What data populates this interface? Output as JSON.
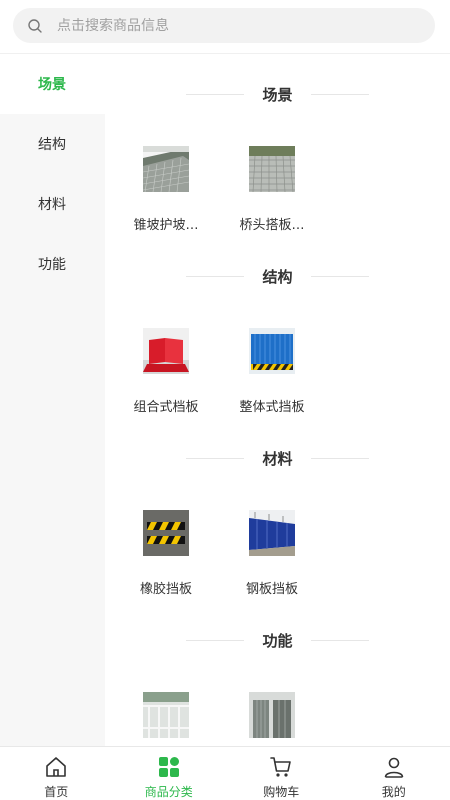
{
  "search": {
    "placeholder": "点击搜索商品信息"
  },
  "sidebar": {
    "active_color": "#2db84c",
    "items": [
      {
        "label": "场景",
        "active": true
      },
      {
        "label": "结构",
        "active": false
      },
      {
        "label": "材料",
        "active": false
      },
      {
        "label": "功能",
        "active": false
      }
    ]
  },
  "sections": [
    {
      "title": "场景",
      "products": [
        {
          "label": "锥坡护坡…",
          "image": "embankment-photo"
        },
        {
          "label": "桥头搭板…",
          "image": "paved-slab-photo"
        }
      ]
    },
    {
      "title": "结构",
      "products": [
        {
          "label": "组合式档板",
          "image": "red-barrier-photo"
        },
        {
          "label": "整体式挡板",
          "image": "blue-barrier-photo"
        }
      ]
    },
    {
      "title": "材料",
      "products": [
        {
          "label": "橡胶挡板",
          "image": "rubber-bump-photo"
        },
        {
          "label": "钢板挡板",
          "image": "steel-fence-photo"
        }
      ]
    },
    {
      "title": "功能",
      "products": [
        {
          "label": "",
          "image": "railing-photo"
        },
        {
          "label": "",
          "image": "gate-photo"
        }
      ]
    }
  ],
  "tabbar": {
    "items": [
      {
        "label": "首页",
        "icon": "home-icon",
        "active": false
      },
      {
        "label": "商品分类",
        "icon": "category-icon",
        "active": true
      },
      {
        "label": "购物车",
        "icon": "cart-icon",
        "active": false
      },
      {
        "label": "我的",
        "icon": "user-icon",
        "active": false
      }
    ]
  }
}
